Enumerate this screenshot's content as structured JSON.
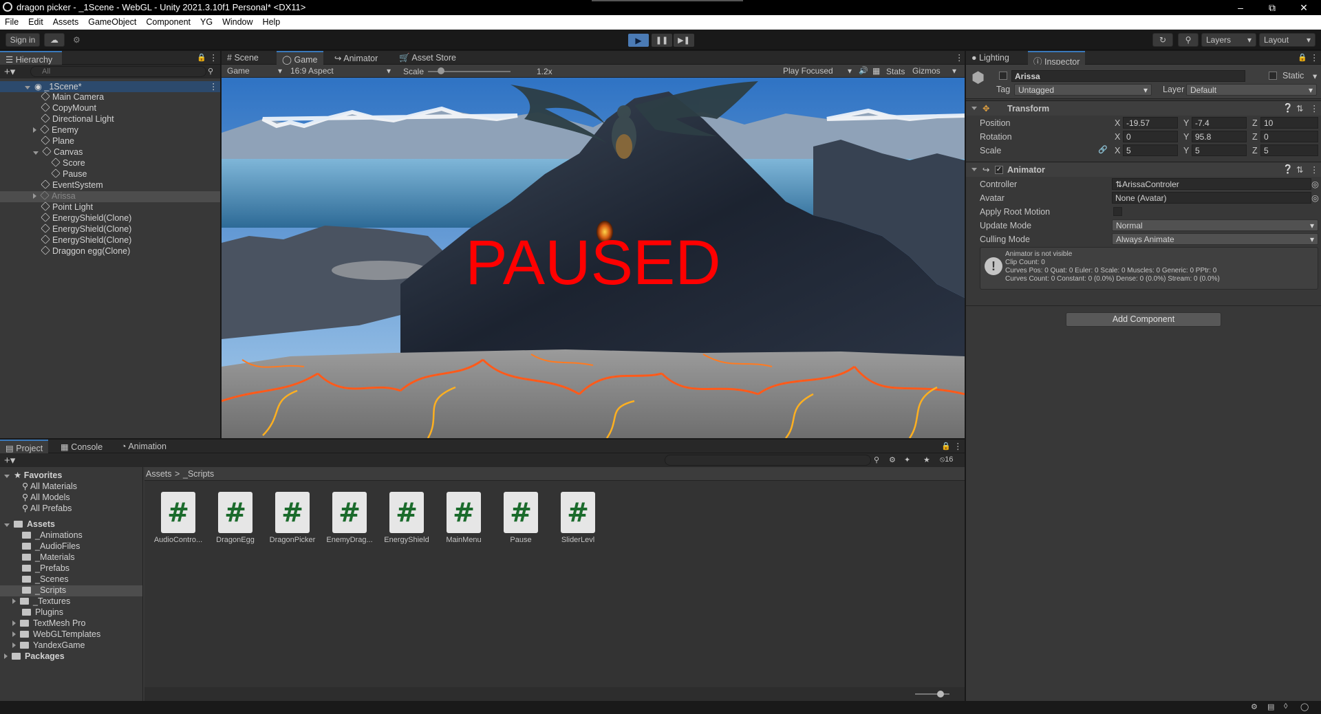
{
  "window": {
    "title": "dragon picker - _1Scene - WebGL - Unity 2021.3.10f1 Personal* <DX11>"
  },
  "menu": [
    "File",
    "Edit",
    "Assets",
    "GameObject",
    "Component",
    "YG",
    "Window",
    "Help"
  ],
  "toolbar": {
    "signin": "Sign in",
    "layers": "Layers",
    "layout": "Layout"
  },
  "hierarchy": {
    "tab": "Hierarchy",
    "search_placeholder": "All",
    "scene": "_1Scene*",
    "items": [
      "Main Camera",
      "CopyMount",
      "Directional Light",
      "Enemy",
      "Plane",
      "Canvas",
      "Score",
      "Pause",
      "EventSystem",
      "Arissa",
      "Point Light",
      "EnergyShield(Clone)",
      "EnergyShield(Clone)",
      "EnergyShield(Clone)",
      "Draggon egg(Clone)"
    ]
  },
  "game": {
    "tabs": [
      "Scene",
      "Game",
      "Animator",
      "Asset Store"
    ],
    "display": "Game",
    "aspect": "16:9 Aspect",
    "scale_label": "Scale",
    "scale_value": "1.2x",
    "play_focused": "Play Focused",
    "stats": "Stats",
    "gizmos": "Gizmos",
    "paused_text": "PAUSED"
  },
  "inspector": {
    "tabs": [
      "Lighting",
      "Inspector"
    ],
    "object_name": "Arissa",
    "static_label": "Static",
    "tag_label": "Tag",
    "tag_value": "Untagged",
    "layer_label": "Layer",
    "layer_value": "Default",
    "transform": {
      "title": "Transform",
      "rows": [
        {
          "label": "Position",
          "x": "-19.57",
          "y": "-7.4",
          "z": "10"
        },
        {
          "label": "Rotation",
          "x": "0",
          "y": "95.8",
          "z": "0"
        },
        {
          "label": "Scale",
          "x": "5",
          "y": "5",
          "z": "5"
        }
      ]
    },
    "animator": {
      "title": "Animator",
      "controller_label": "Controller",
      "controller_value": "ArissaControler",
      "avatar_label": "Avatar",
      "avatar_value": "None (Avatar)",
      "root_motion_label": "Apply Root Motion",
      "update_mode_label": "Update Mode",
      "update_mode_value": "Normal",
      "culling_mode_label": "Culling Mode",
      "culling_mode_value": "Always Animate",
      "info": [
        "Animator is not visible",
        "Clip Count: 0",
        "Curves Pos: 0 Quat: 0 Euler: 0 Scale: 0 Muscles: 0 Generic: 0 PPtr: 0",
        "Curves Count: 0 Constant: 0 (0.0%) Dense: 0 (0.0%) Stream: 0 (0.0%)"
      ]
    },
    "add_component": "Add Component"
  },
  "project": {
    "tabs": [
      "Project",
      "Console",
      "Animation"
    ],
    "hidden_count": "16",
    "favorites_label": "Favorites",
    "favorites": [
      "All Materials",
      "All Models",
      "All Prefabs"
    ],
    "assets_label": "Assets",
    "folders": [
      "_Animations",
      "_AudioFiles",
      "_Materials",
      "_Prefabs",
      "_Scenes",
      "_Scripts",
      "_Textures",
      "Plugins",
      "TextMesh Pro",
      "WebGLTemplates",
      "YandexGame"
    ],
    "packages_label": "Packages",
    "breadcrumb": [
      "Assets",
      "_Scripts"
    ],
    "scripts": [
      "AudioContro...",
      "DragonEgg",
      "DragonPicker",
      "EnemyDrag...",
      "EnergyShield",
      "MainMenu",
      "Pause",
      "SliderLevl"
    ]
  },
  "colors": {
    "accent": "#3a79bb",
    "paused": "#ff0000",
    "lava": "#ff5a1a"
  }
}
